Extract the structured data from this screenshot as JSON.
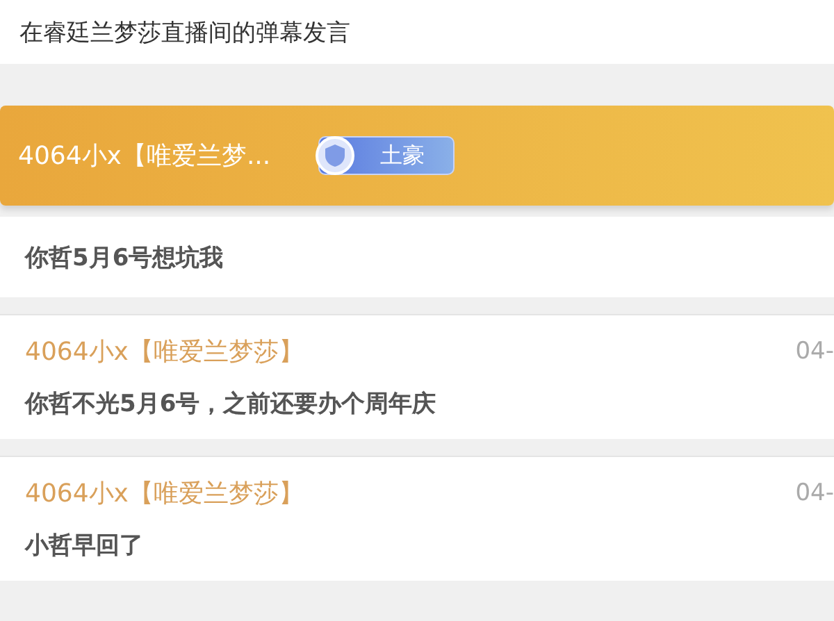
{
  "header": {
    "title": "在睿廷兰梦莎直播间的弹幕发言"
  },
  "messages": [
    {
      "kind": "featured",
      "user": "4064小x【唯爱兰梦...",
      "badge": "土豪",
      "text": "你哲5月6号想坑我"
    },
    {
      "kind": "normal",
      "user": "4064小x【唯爱兰梦莎】",
      "time": "04-",
      "text": "你哲不光5月6号，之前还要办个周年庆"
    },
    {
      "kind": "normal",
      "user": "4064小x【唯爱兰梦莎】",
      "time": "04-",
      "text": "小哲早回了"
    }
  ]
}
